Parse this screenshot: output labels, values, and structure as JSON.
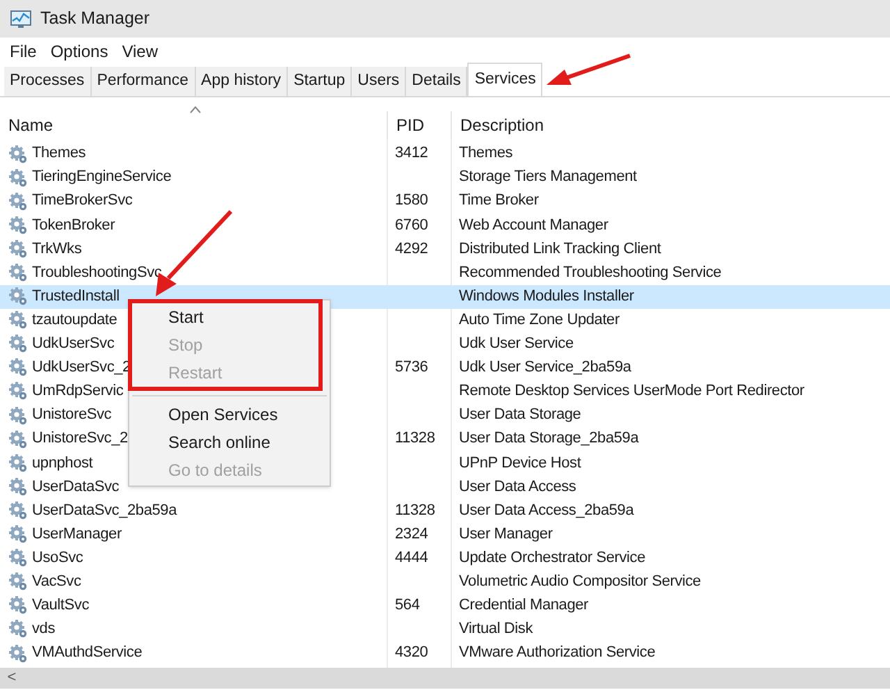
{
  "window": {
    "title": "Task Manager"
  },
  "menu_bar": [
    "File",
    "Options",
    "View"
  ],
  "tabs": [
    {
      "label": "Processes",
      "selected": false
    },
    {
      "label": "Performance",
      "selected": false
    },
    {
      "label": "App history",
      "selected": false
    },
    {
      "label": "Startup",
      "selected": false
    },
    {
      "label": "Users",
      "selected": false
    },
    {
      "label": "Details",
      "selected": false
    },
    {
      "label": "Services",
      "selected": true
    }
  ],
  "table": {
    "columns": [
      "Name",
      "PID",
      "Description"
    ],
    "rows": [
      {
        "name": "Themes",
        "pid": "3412",
        "description": "Themes",
        "selected": false
      },
      {
        "name": "TieringEngineService",
        "description": "Storage Tiers Management",
        "selected": false
      },
      {
        "name": "TimeBrokerSvc",
        "pid": "1580",
        "description": "Time Broker",
        "selected": false
      },
      {
        "name": "TokenBroker",
        "pid": "6760",
        "description": "Web Account Manager",
        "selected": false
      },
      {
        "name": "TrkWks",
        "pid": "4292",
        "description": "Distributed Link Tracking Client",
        "selected": false
      },
      {
        "name": "TroubleshootingSvc",
        "description": "Recommended Troubleshooting Service",
        "selected": false
      },
      {
        "name": "TrustedInstall",
        "description": "Windows Modules Installer",
        "selected": true
      },
      {
        "name": "tzautoupdate",
        "description": "Auto Time Zone Updater",
        "selected": false
      },
      {
        "name": "UdkUserSvc",
        "description": "Udk User Service",
        "selected": false
      },
      {
        "name": "UdkUserSvc_2",
        "pid": "5736",
        "description": "Udk User Service_2ba59a",
        "selected": false
      },
      {
        "name": "UmRdpServic",
        "description": "Remote Desktop Services UserMode Port Redirector",
        "selected": false
      },
      {
        "name": "UnistoreSvc",
        "description": "User Data Storage",
        "selected": false
      },
      {
        "name": "UnistoreSvc_2",
        "pid": "11328",
        "description": "User Data Storage_2ba59a",
        "selected": false
      },
      {
        "name": "upnphost",
        "description": "UPnP Device Host",
        "selected": false
      },
      {
        "name": "UserDataSvc",
        "description": "User Data Access",
        "selected": false
      },
      {
        "name": "UserDataSvc_2ba59a",
        "pid": "11328",
        "description": "User Data Access_2ba59a",
        "selected": false
      },
      {
        "name": "UserManager",
        "pid": "2324",
        "description": "User Manager",
        "selected": false
      },
      {
        "name": "UsoSvc",
        "pid": "4444",
        "description": "Update Orchestrator Service",
        "selected": false
      },
      {
        "name": "VacSvc",
        "description": "Volumetric Audio Compositor Service",
        "selected": false
      },
      {
        "name": "VaultSvc",
        "pid": "564",
        "description": "Credential Manager",
        "selected": false
      },
      {
        "name": "vds",
        "description": "Virtual Disk",
        "selected": false
      },
      {
        "name": "VMAuthdService",
        "pid": "4320",
        "description": "VMware Authorization Service",
        "selected": false
      }
    ]
  },
  "context_menu": [
    {
      "kind": "item",
      "label": "Start",
      "disabled": false
    },
    {
      "kind": "item",
      "label": "Stop",
      "disabled": true
    },
    {
      "kind": "item",
      "label": "Restart",
      "disabled": true
    },
    {
      "kind": "separator"
    },
    {
      "kind": "item",
      "label": "Open Services",
      "disabled": false
    },
    {
      "kind": "item",
      "label": "Search online",
      "disabled": false
    },
    {
      "kind": "item",
      "label": "Go to details",
      "disabled": true
    }
  ],
  "horizontal_scrollbar": {
    "arrow": "<"
  }
}
